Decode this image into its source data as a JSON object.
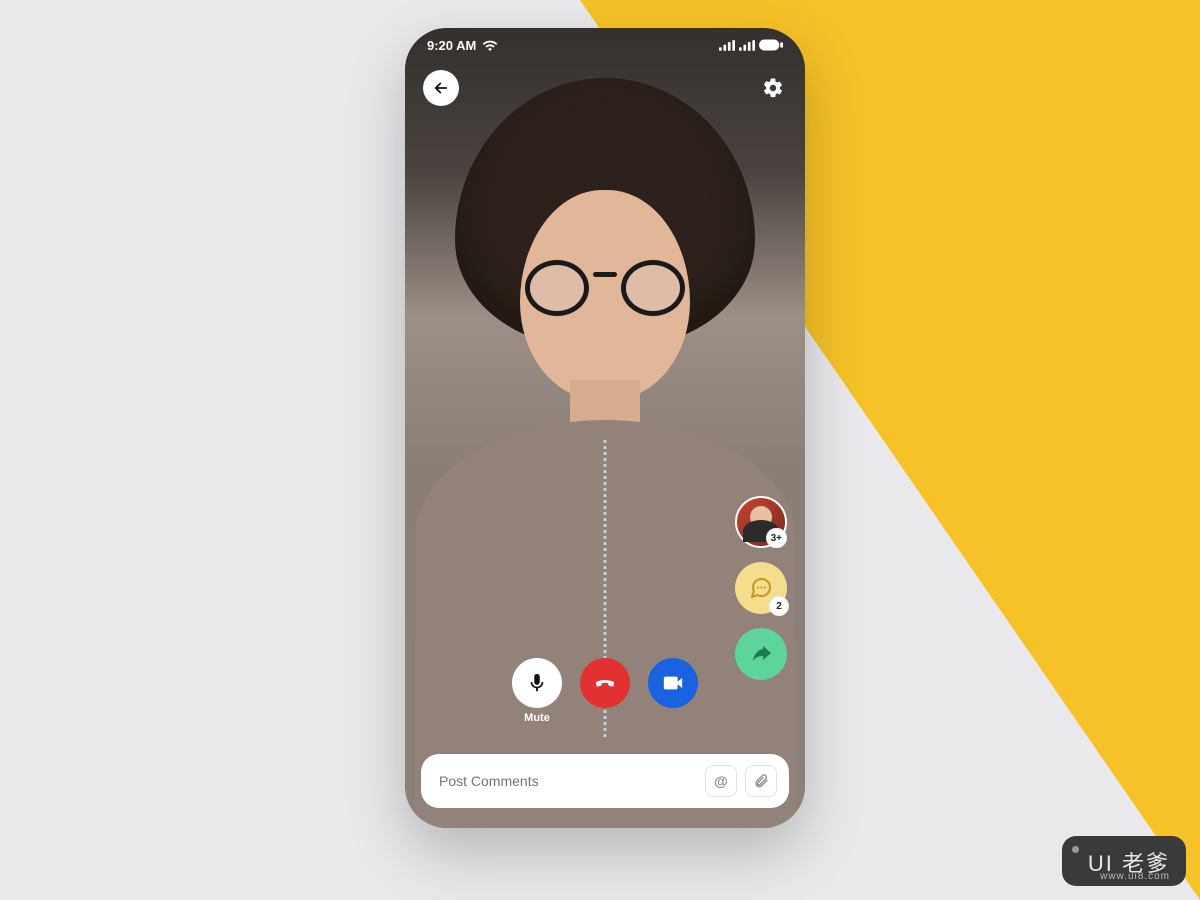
{
  "status_bar": {
    "time": "9:20 AM"
  },
  "side_actions": {
    "participants_badge": "3+",
    "chat_badge": "2"
  },
  "call_controls": {
    "mute_label": "Mute"
  },
  "comment": {
    "placeholder": "Post Comments",
    "mention_label": "@"
  },
  "watermark": {
    "brand": "UI 老爹",
    "url": "www.ui8.com"
  }
}
